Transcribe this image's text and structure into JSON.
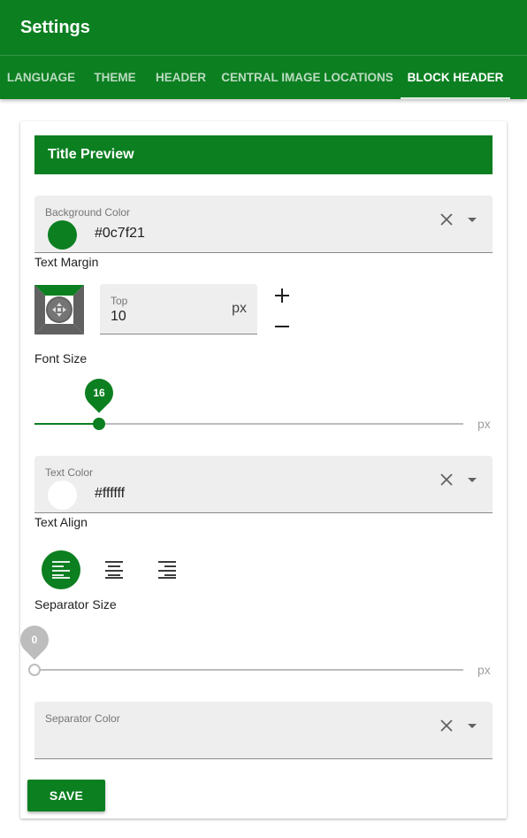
{
  "appbar": {
    "title": "Settings"
  },
  "tabs": [
    {
      "label": "LANGUAGE",
      "active": false
    },
    {
      "label": "THEME",
      "active": false
    },
    {
      "label": "HEADER",
      "active": false
    },
    {
      "label": "CENTRAL IMAGE LOCATIONS",
      "active": false
    },
    {
      "label": "BLOCK HEADER",
      "active": true
    }
  ],
  "preview": {
    "title": "Title Preview"
  },
  "background_color": {
    "label": "Background Color",
    "value": "#0c7f21",
    "swatch": "#0c7f21"
  },
  "text_margin": {
    "label": "Text Margin",
    "side_label": "Top",
    "value": "10",
    "unit": "px"
  },
  "font_size": {
    "label": "Font Size",
    "value": "16",
    "unit": "px",
    "min": 0,
    "max": 72
  },
  "text_color": {
    "label": "Text Color",
    "value": "#ffffff",
    "swatch": "#ffffff"
  },
  "text_align": {
    "label": "Text Align",
    "options": [
      "left",
      "center",
      "right"
    ],
    "selected": "left"
  },
  "separator_size": {
    "label": "Separator Size",
    "value": "0",
    "unit": "px"
  },
  "separator_color": {
    "label": "Separator Color",
    "value": ""
  },
  "actions": {
    "save_label": "SAVE"
  },
  "colors": {
    "accent": "#0c7f21",
    "field_bg": "#eeeeee",
    "inactive_tab": "rgba(255,255,255,0.72)"
  }
}
